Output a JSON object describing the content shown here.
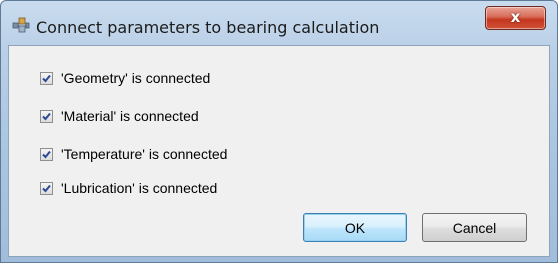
{
  "window": {
    "title": "Connect parameters to bearing calculation",
    "app_icon": "connect-parameters-icon",
    "close_label": "x"
  },
  "checks": [
    {
      "label": "'Geometry' is connected",
      "checked": true
    },
    {
      "label": "'Material' is connected",
      "checked": true
    },
    {
      "label": "'Temperature' is connected",
      "checked": true
    },
    {
      "label": "'Lubrication' is connected",
      "checked": true
    }
  ],
  "buttons": {
    "ok": "OK",
    "cancel": "Cancel"
  },
  "colors": {
    "titlebar": "#b9cfe6",
    "close": "#c4371f",
    "client": "#f0f0f0",
    "check": "#2b4a91",
    "default_button_border": "#3c7fb1"
  }
}
